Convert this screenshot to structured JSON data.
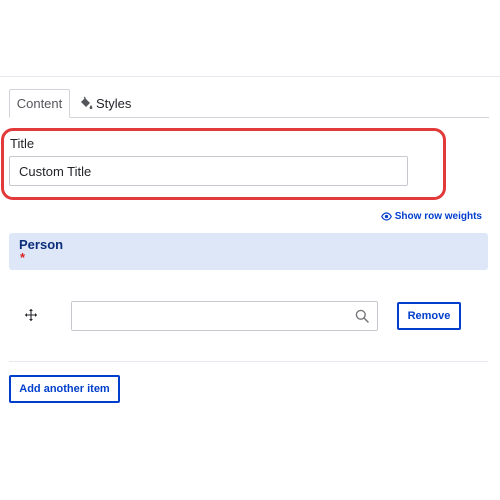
{
  "tabs": [
    {
      "label": "Content",
      "active": true
    },
    {
      "label": "Styles",
      "icon": "paint-bucket-icon",
      "active": false
    }
  ],
  "title_field": {
    "label": "Title",
    "value": "Custom Title",
    "highlight_color": "#e23a3a"
  },
  "row_weights": {
    "label": "Show row weights",
    "icon": "eye-icon"
  },
  "person": {
    "label": "Person",
    "required_mark": "*",
    "header_color": "#dde7f8"
  },
  "row": {
    "drag_icon": "move-handle-icon",
    "search_value": "",
    "search_icon": "search-icon",
    "remove_label": "Remove"
  },
  "add_item": {
    "label": "Add another item"
  },
  "colors": {
    "accent": "#003ecc",
    "required": "#dc2323"
  }
}
